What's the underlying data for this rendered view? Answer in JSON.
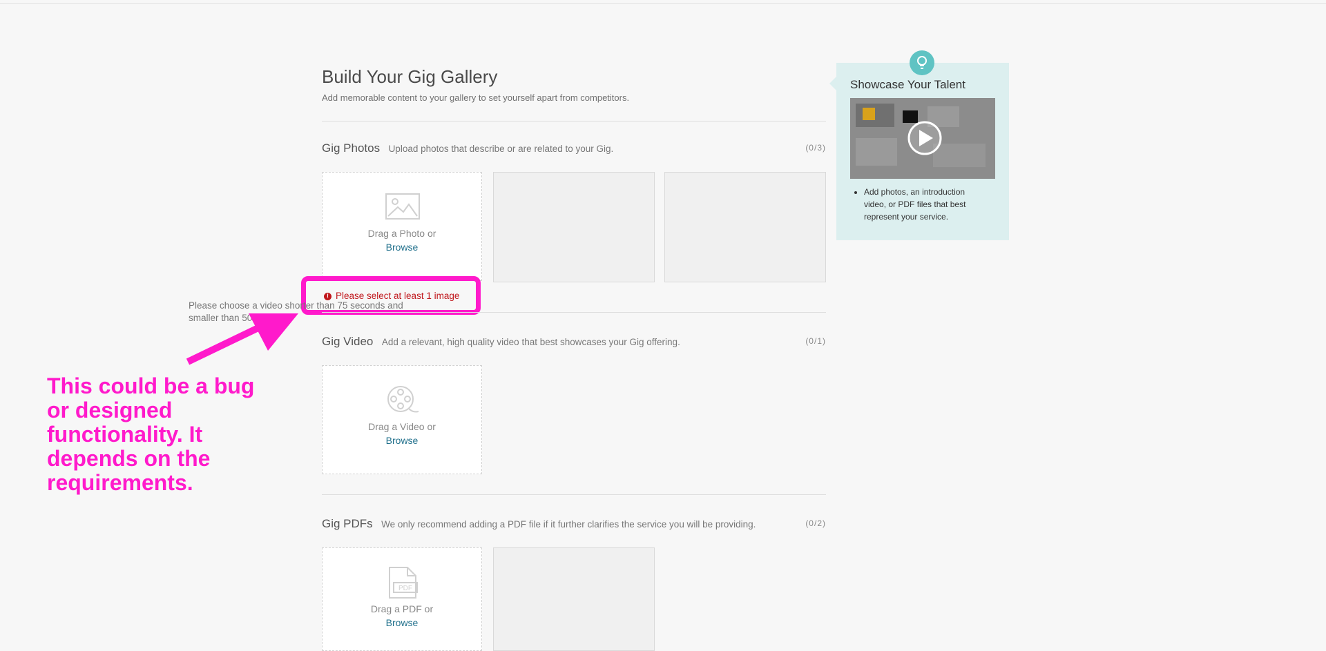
{
  "header": {
    "title": "Build Your Gig Gallery",
    "subtitle": "Add memorable content to your gallery to set yourself apart from competitors."
  },
  "photos": {
    "title": "Gig Photos",
    "desc": "Upload photos that describe or are related to your Gig.",
    "count": "(0/3)",
    "drop_text": "Drag a Photo or",
    "browse": "Browse",
    "error": "Please select at least 1 image"
  },
  "video": {
    "title": "Gig Video",
    "desc": "Add a relevant, high quality video that best showcases your Gig offering.",
    "count": "(0/1)",
    "drop_text": "Drag a Video or",
    "browse": "Browse",
    "note": "Please choose a video shorter than 75 seconds and smaller than 50MB"
  },
  "pdfs": {
    "title": "Gig PDFs",
    "desc": "We only recommend adding a PDF file if it further clarifies the service you will be providing.",
    "count": "(0/2)",
    "drop_text": "Drag a PDF or",
    "browse": "Browse",
    "icon_label": "PDF"
  },
  "side": {
    "title": "Showcase Your Talent",
    "bullet": "Add photos, an introduction video, or PDF files that best represent your service."
  },
  "annotation": {
    "text": "This could be a bug or designed functionality. It depends on the requirements."
  },
  "colors": {
    "accent": "#ff1acb",
    "error": "#c0161b",
    "link": "#1f6f8b",
    "panel": "#dcefef",
    "bulb": "#5fc3c3"
  },
  "icons": {
    "photo": "image-placeholder-icon",
    "video": "film-reel-icon",
    "pdf": "pdf-file-icon",
    "bulb": "lightbulb-icon",
    "play": "play-icon",
    "error": "exclamation-circle-icon"
  }
}
